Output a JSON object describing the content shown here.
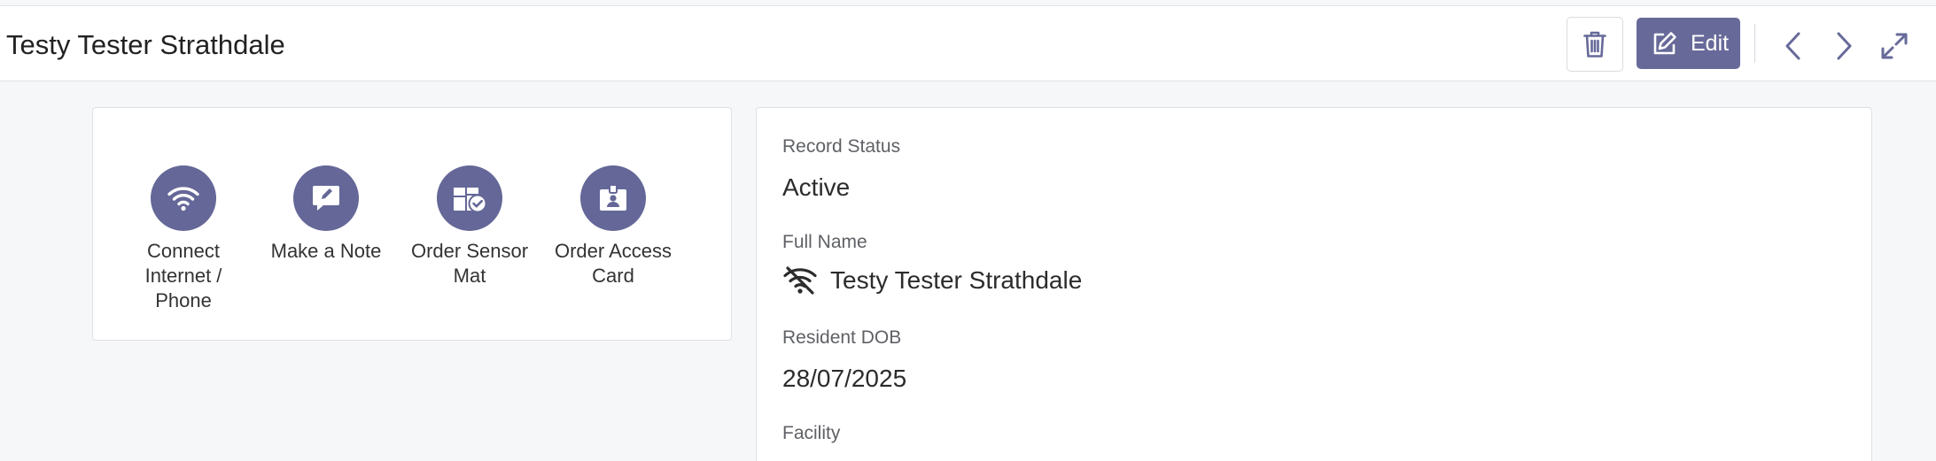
{
  "header": {
    "title": "Testy Tester Strathdale",
    "edit_label": "Edit",
    "icons": [
      "trash-icon",
      "pencil-square-icon",
      "chevron-left-icon",
      "chevron-right-icon",
      "expand-icon"
    ]
  },
  "actions": [
    {
      "label": "Connect Internet / Phone",
      "icon": "wifi-icon"
    },
    {
      "label": "Make a Note",
      "icon": "note-icon"
    },
    {
      "label": "Order Sensor Mat",
      "icon": "sensor-mat-icon"
    },
    {
      "label": "Order Access Card",
      "icon": "access-card-icon"
    }
  ],
  "details": {
    "record_status_label": "Record Status",
    "record_status_value": "Active",
    "full_name_label": "Full Name",
    "full_name_value": "Testy Tester Strathdale",
    "full_name_icon": "wifi-off-icon",
    "dob_label": "Resident DOB",
    "dob_value": "28/07/2025",
    "facility_label": "Facility"
  },
  "colors": {
    "accent": "#676a99",
    "action_circle": "#646797",
    "background": "#f6f7f9"
  }
}
